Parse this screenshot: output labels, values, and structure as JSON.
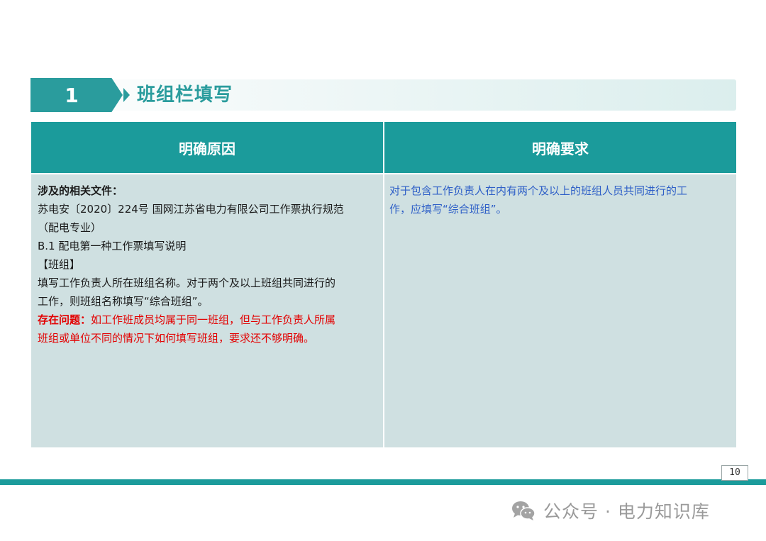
{
  "section": {
    "number": "1",
    "title": "班组栏填写"
  },
  "table": {
    "headers": [
      "明确原因",
      "明确要求"
    ],
    "left_lines": [
      {
        "text": "涉及的相关文件：",
        "style": "bold"
      },
      {
        "text": "苏电安〔2020〕224号 国网江苏省电力有限公司工作票执行规范",
        "style": "normal"
      },
      {
        "text": "（配电专业）",
        "style": "normal"
      },
      {
        "text": "B.1 配电第一种工作票填写说明",
        "style": "normal"
      },
      {
        "text": "【班组】",
        "style": "normal"
      },
      {
        "text": "填写工作负责人所在班组名称。对于两个及以上班组共同进行的",
        "style": "normal"
      },
      {
        "text": "工作，则班组名称填写“综合班组”。",
        "style": "normal"
      }
    ],
    "issue": {
      "label": "存在问题：",
      "line1": "如工作班成员均属于同一班组，但与工作负责人所属",
      "line2": "班组或单位不同的情况下如何填写班组，要求还不够明确。"
    },
    "right_lines": [
      "对于包含工作负责人在内有两个及以上的班组人员共同进行的工",
      "作，应填写“综合班组”。"
    ]
  },
  "footer": {
    "page_number": "10",
    "watermark": "公众号 · 电力知识库"
  },
  "colors": {
    "teal": "#1b9b9b",
    "cell_bg": "#cfe0e1",
    "issue_red": "#e30000",
    "requirement_blue": "#2e5fc7"
  },
  "icons": {
    "wechat": "wechat-icon"
  }
}
